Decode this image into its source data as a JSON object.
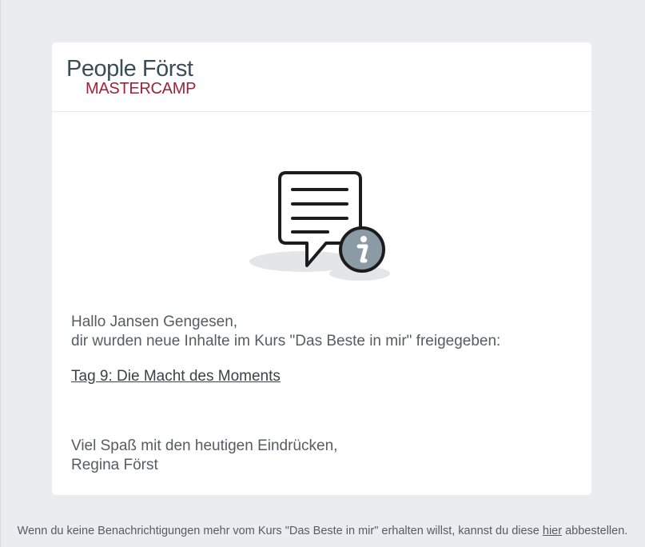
{
  "brand": {
    "name_line1": "People Först",
    "name_line2": "MASTERCAMP"
  },
  "illustration": {
    "icon": "message-info-icon"
  },
  "message": {
    "greeting": "Hallo Jansen Gengesen,",
    "intro": "dir wurden neue Inhalte im Kurs \"Das Beste in mir\" freigegeben:",
    "link_text": "Tag 9: Die Macht des Moments",
    "closing": "Viel Spaß mit den heutigen Eindrücken,",
    "signature": "Regina Först"
  },
  "footer": {
    "text": "Wenn du keine Benachrichtigungen mehr vom Kurs \"Das Beste in mir\" erhalten willst, kannst du diese ",
    "link_text": "hier",
    "tail": " abbestellen."
  },
  "colors": {
    "background": "#e9edf0",
    "brand_gray": "#3c4d58",
    "brand_red": "#a0213a",
    "info_badge": "#8a9ba5"
  }
}
